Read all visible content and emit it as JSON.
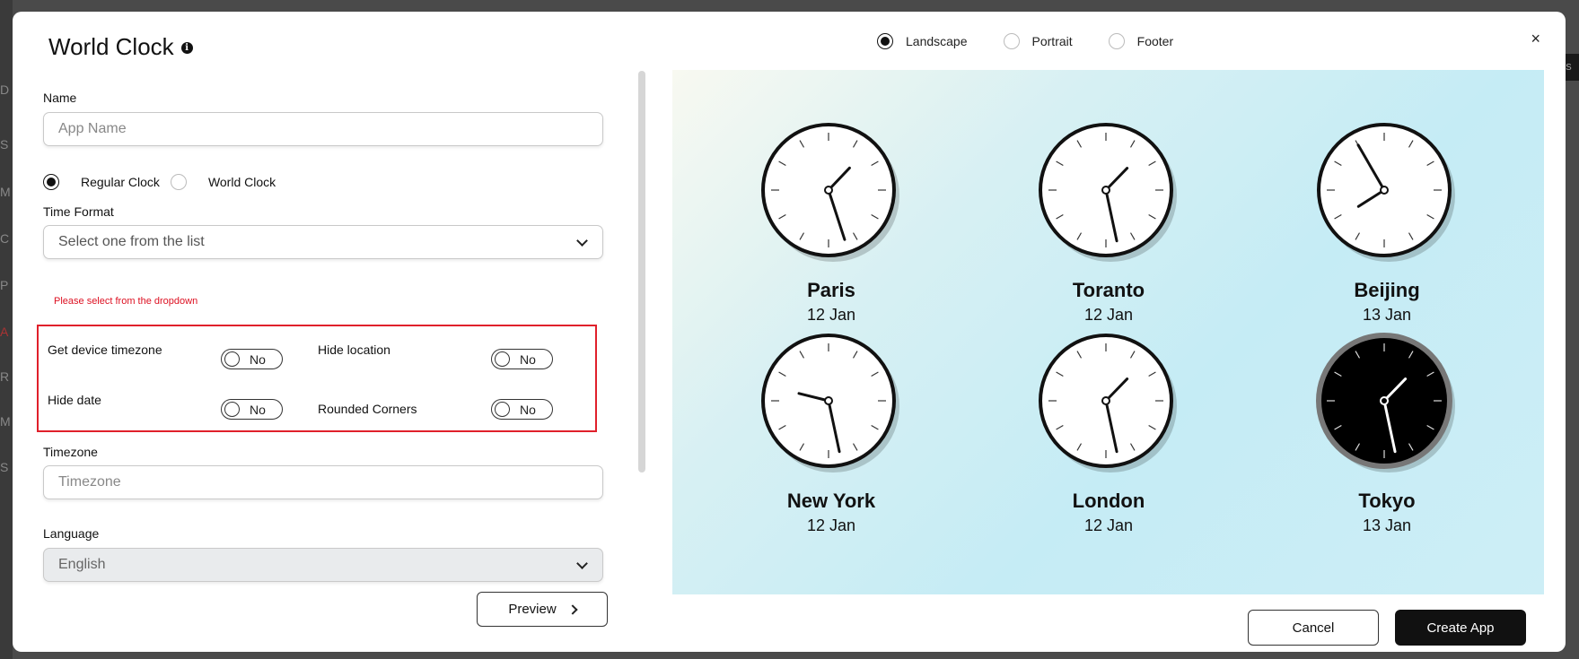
{
  "backdrop": {
    "left_letters": [
      "D",
      "S",
      "M",
      "C",
      "P",
      "A",
      "R",
      "M",
      "S"
    ],
    "right_text": "es"
  },
  "modal": {
    "title": "World Clock",
    "close_label": "×"
  },
  "orientation": {
    "options": [
      {
        "label": "Landscape",
        "selected": true
      },
      {
        "label": "Portrait",
        "selected": false
      },
      {
        "label": "Footer",
        "selected": false
      }
    ]
  },
  "form": {
    "name_label": "Name",
    "name_placeholder": "App Name",
    "clock_type_options": [
      {
        "label": "Regular Clock",
        "selected": true
      },
      {
        "label": "World Clock",
        "selected": false
      }
    ],
    "time_format_label": "Time Format",
    "time_format_placeholder": "Select one from the list",
    "time_format_error": "Please select from the dropdown",
    "toggles": {
      "device_timezone": {
        "label": "Get device timezone",
        "value": "No"
      },
      "hide_location": {
        "label": "Hide location",
        "value": "No"
      },
      "hide_date": {
        "label": "Hide date",
        "value": "No"
      },
      "rounded_corners": {
        "label": "Rounded Corners",
        "value": "No"
      }
    },
    "timezone_label": "Timezone",
    "timezone_placeholder": "Timezone",
    "language_label": "Language",
    "language_value": "English",
    "preview_button": "Preview"
  },
  "preview": {
    "clocks": [
      {
        "city": "Paris",
        "date": "12 Jan",
        "hour": 1,
        "minute": 27,
        "theme": "light"
      },
      {
        "city": "Toranto",
        "date": "12 Jan",
        "hour": 1,
        "minute": 28,
        "theme": "light"
      },
      {
        "city": "Beijing",
        "date": "13 Jan",
        "hour": 7,
        "minute": 55,
        "theme": "light"
      },
      {
        "city": "New York",
        "date": "12 Jan",
        "hour": 9,
        "minute": 28,
        "theme": "light"
      },
      {
        "city": "London",
        "date": "12 Jan",
        "hour": 1,
        "minute": 28,
        "theme": "light"
      },
      {
        "city": "Tokyo",
        "date": "13 Jan",
        "hour": 1,
        "minute": 28,
        "theme": "dark"
      }
    ]
  },
  "footer": {
    "cancel_label": "Cancel",
    "create_label": "Create App"
  },
  "colors": {
    "accent": "#111111",
    "error": "#dd1122",
    "highlight_box": "#e0202b",
    "preview_bg": "#c5ecf5"
  }
}
